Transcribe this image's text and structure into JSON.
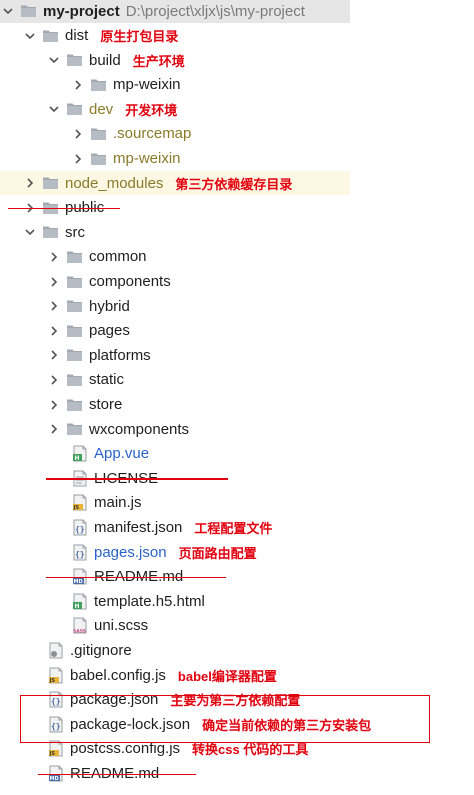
{
  "root": {
    "label": "my-project",
    "path": "D:\\project\\xljx\\js\\my-project"
  },
  "colors": {
    "annotation": "#e2000f",
    "folder": "#a2a9b1",
    "vue_green": "#3fa15c",
    "json_blue": "#2a64c8"
  },
  "items": [
    {
      "label": "dist",
      "note": "原生打包目录",
      "icon": "folder-icon",
      "expanded": true
    },
    {
      "label": "build",
      "note": "生产环境",
      "icon": "folder-icon",
      "expanded": true
    },
    {
      "label": "mp-weixin",
      "note": "",
      "icon": "folder-icon",
      "expanded": false
    },
    {
      "label": "dev",
      "note": "开发环境",
      "icon": "folder-icon",
      "expanded": true
    },
    {
      "label": ".sourcemap",
      "note": "",
      "icon": "folder-icon",
      "expanded": false
    },
    {
      "label": "mp-weixin",
      "note": "",
      "icon": "folder-icon",
      "expanded": false
    },
    {
      "label": "node_modules",
      "note": "第三方依赖缓存目录",
      "icon": "folder-icon",
      "expanded": false
    },
    {
      "label": "public",
      "note": "",
      "icon": "folder-icon",
      "expanded": false
    },
    {
      "label": "src",
      "note": "",
      "icon": "folder-icon",
      "expanded": true
    },
    {
      "label": "common",
      "note": "",
      "icon": "folder-icon",
      "expanded": false
    },
    {
      "label": "components",
      "note": "",
      "icon": "folder-icon",
      "expanded": false
    },
    {
      "label": "hybrid",
      "note": "",
      "icon": "folder-icon",
      "expanded": false
    },
    {
      "label": "pages",
      "note": "",
      "icon": "folder-icon",
      "expanded": false
    },
    {
      "label": "platforms",
      "note": "",
      "icon": "folder-icon",
      "expanded": false
    },
    {
      "label": "static",
      "note": "",
      "icon": "folder-icon",
      "expanded": false
    },
    {
      "label": "store",
      "note": "",
      "icon": "folder-icon",
      "expanded": false
    },
    {
      "label": "wxcomponents",
      "note": "",
      "icon": "folder-icon",
      "expanded": false
    },
    {
      "label": "App.vue",
      "note": "",
      "icon": "vue-file-icon"
    },
    {
      "label": "LICENSE",
      "note": "",
      "icon": "text-file-icon"
    },
    {
      "label": "main.js",
      "note": "",
      "icon": "js-file-icon"
    },
    {
      "label": "manifest.json",
      "note": "工程配置文件",
      "icon": "json-file-icon"
    },
    {
      "label": "pages.json",
      "note": "页面路由配置",
      "icon": "json-file-icon"
    },
    {
      "label": "README.md",
      "note": "",
      "icon": "md-file-icon"
    },
    {
      "label": "template.h5.html",
      "note": "",
      "icon": "html-file-icon"
    },
    {
      "label": "uni.scss",
      "note": "",
      "icon": "sass-file-icon"
    },
    {
      "label": ".gitignore",
      "note": "",
      "icon": "gitignore-file-icon"
    },
    {
      "label": "babel.config.js",
      "note": "babel编译器配置",
      "icon": "js-file-icon"
    },
    {
      "label": "package.json",
      "note": "主要为第三方依赖配置",
      "icon": "json-file-icon"
    },
    {
      "label": "package-lock.json",
      "note": "确定当前依赖的第三方安装包",
      "icon": "json-file-icon"
    },
    {
      "label": "postcss.config.js",
      "note": "转换css 代码的工具",
      "icon": "js-file-icon"
    },
    {
      "label": "README.md",
      "note": "",
      "icon": "md-file-icon"
    }
  ]
}
